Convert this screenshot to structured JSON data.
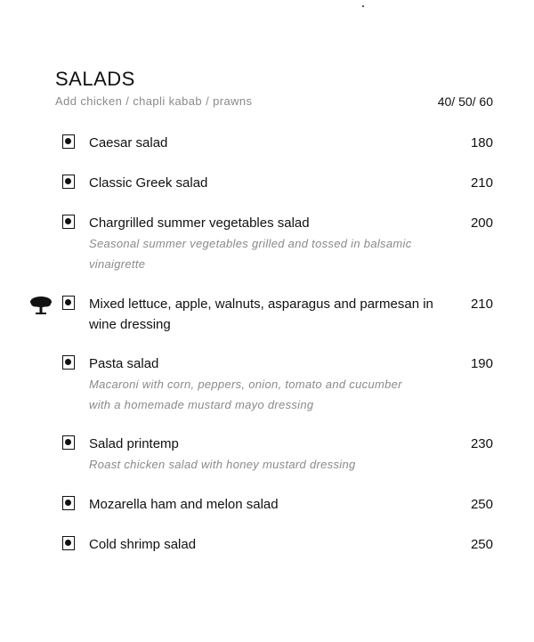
{
  "section": {
    "title": "SALADS",
    "addon_text": "Add chicken / chapli kabab / prawns",
    "addon_price": "40/ 50/ 60"
  },
  "items": [
    {
      "name": "Caesar salad",
      "price": "180",
      "desc": ""
    },
    {
      "name": "Classic Greek salad",
      "price": "210",
      "desc": ""
    },
    {
      "name": "Chargrilled summer vegetables salad",
      "price": "200",
      "desc": "Seasonal summer vegetables grilled and tossed in balsamic vinaigrette"
    },
    {
      "name": "Mixed lettuce, apple, walnuts, asparagus and parmesan in wine dressing",
      "price": "210",
      "desc": "",
      "icon": "tree-icon"
    },
    {
      "name": "Pasta salad",
      "price": "190",
      "desc": "Macaroni with corn, peppers, onion, tomato and cucumber with a homemade mustard mayo dressing"
    },
    {
      "name": "Salad printemp",
      "price": "230",
      "desc": "Roast chicken salad with honey mustard dressing"
    },
    {
      "name": "Mozarella ham and melon salad",
      "price": "250",
      "desc": ""
    },
    {
      "name": "Cold shrimp salad",
      "price": "250",
      "desc": ""
    }
  ]
}
